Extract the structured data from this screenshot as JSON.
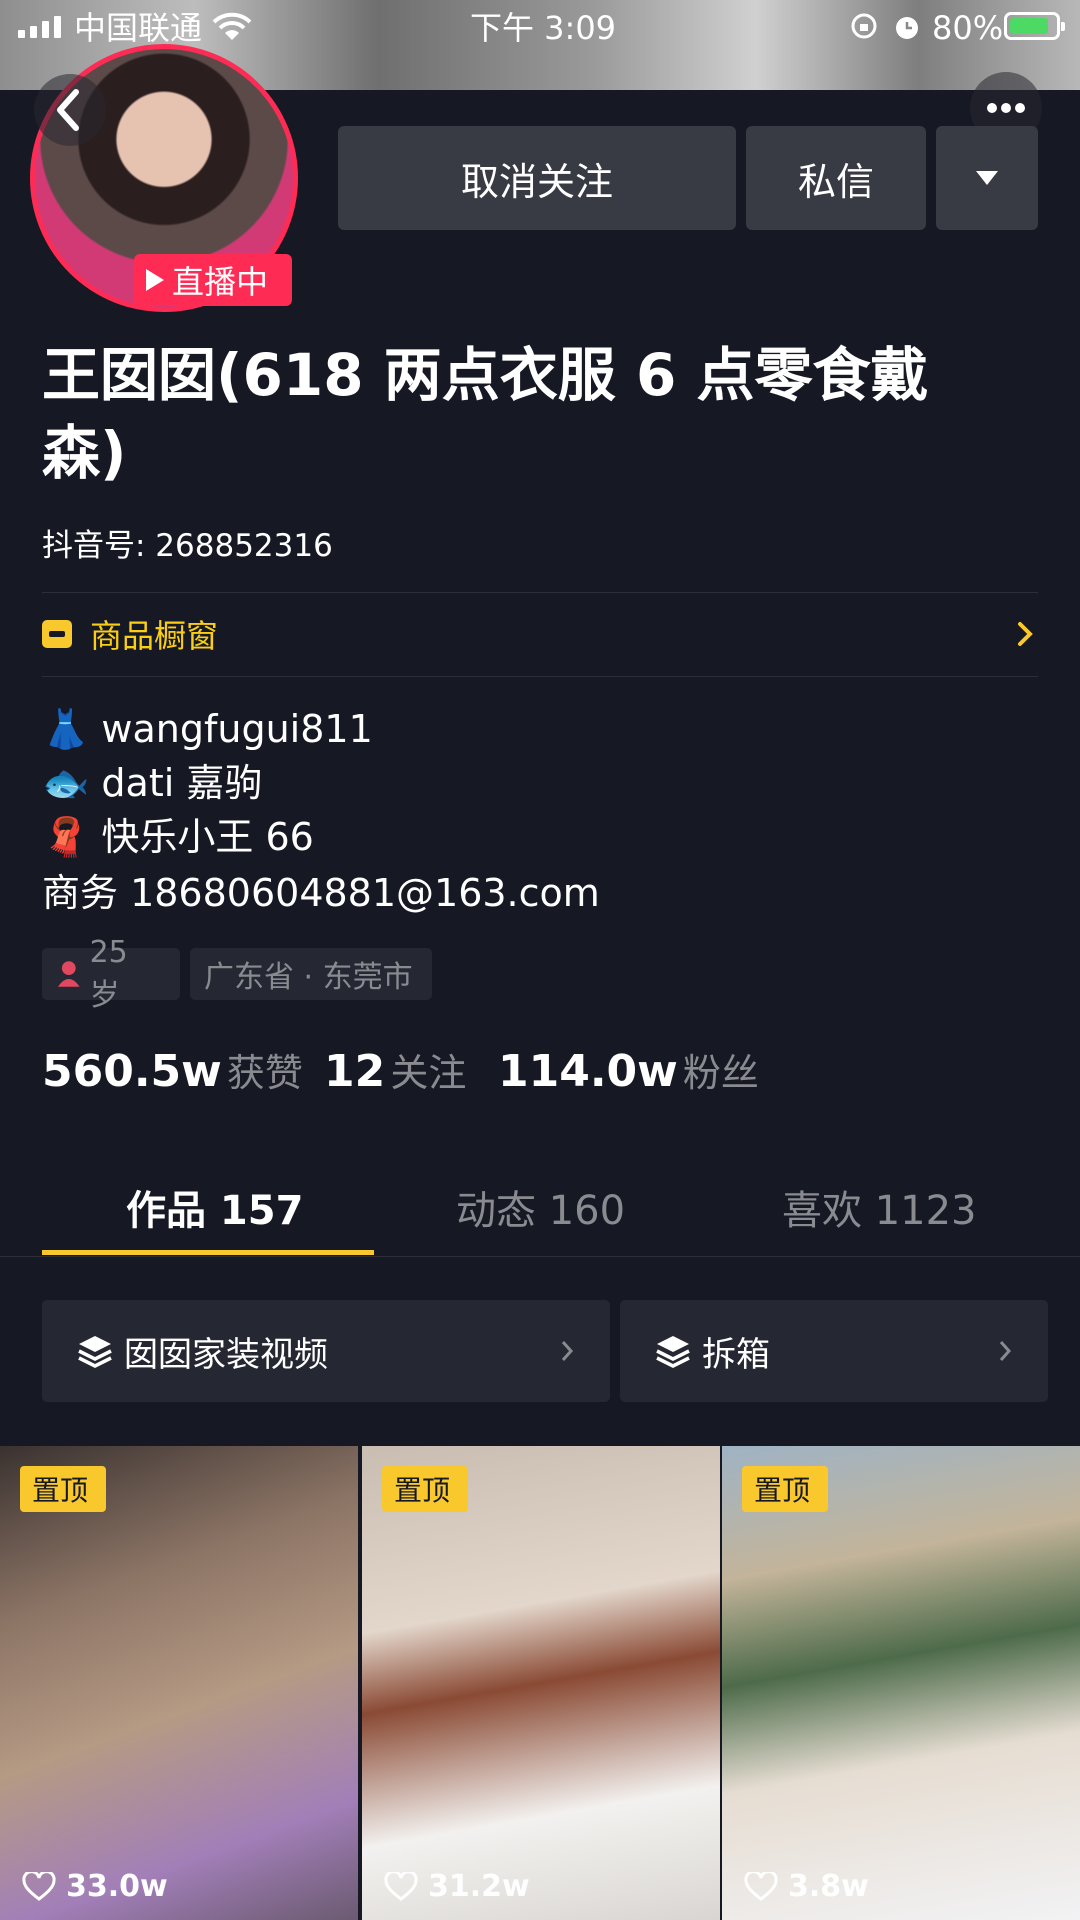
{
  "status_bar": {
    "carrier": "中国联通",
    "time": "下午 3:09",
    "battery": "80%"
  },
  "header": {
    "unfollow_label": "取消关注",
    "message_label": "私信",
    "live_badge": "直播中"
  },
  "profile": {
    "nickname": "王囡囡(618 两点衣服 6 点零食戴森)",
    "douyin_id": "抖音号: 268852316",
    "shop_label": "商品橱窗",
    "bio": [
      {
        "emoji": "👗",
        "text": "wangfugui811"
      },
      {
        "emoji": "🐟",
        "text": "dati 嘉驹"
      },
      {
        "emoji": "🧣",
        "text": "快乐小王 66"
      },
      {
        "emoji": "",
        "text": "商务 18680604881@163.com"
      }
    ],
    "tags": {
      "age": "25 岁",
      "location": "广东省 · 东莞市"
    },
    "stats": {
      "likes_num": "560.5w",
      "likes_label": "获赞",
      "following_num": "12",
      "following_label": "关注",
      "followers_num": "114.0w",
      "followers_label": "粉丝"
    }
  },
  "tabs": [
    {
      "label": "作品 157",
      "active": true
    },
    {
      "label": "动态 160",
      "active": false
    },
    {
      "label": "喜欢 1123",
      "active": false
    }
  ],
  "playlists": [
    {
      "label": "囡囡家装视频"
    },
    {
      "label": "拆箱"
    }
  ],
  "videos": [
    {
      "pin": "置顶",
      "likes": "33.0w"
    },
    {
      "pin": "置顶",
      "likes": "31.2w"
    },
    {
      "pin": "置顶",
      "likes": "3.8w"
    }
  ],
  "colors": {
    "accent": "#f8c82d",
    "live": "#fe2c55",
    "bg": "#161823"
  }
}
